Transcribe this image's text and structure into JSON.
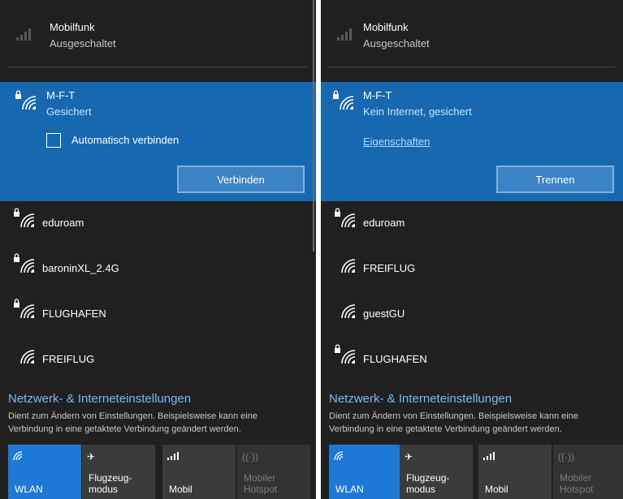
{
  "left": {
    "mobile": {
      "title": "Mobilfunk",
      "status": "Ausgeschaltet"
    },
    "selected": {
      "ssid": "M-F-T",
      "status": "Gesichert",
      "checkbox_label": "Automatisch verbinden",
      "button_label": "Verbinden"
    },
    "networks": [
      "eduroam",
      "baroninXL_2.4G",
      "FLUGHAFEN",
      "FREIFLUG"
    ]
  },
  "right": {
    "mobile": {
      "title": "Mobilfunk",
      "status": "Ausgeschaltet"
    },
    "selected": {
      "ssid": "M-F-T",
      "status": "Kein Internet, gesichert",
      "link_label": "Eigenschaften",
      "button_label": "Trennen"
    },
    "networks": [
      "eduroam",
      "FREIFLUG",
      "guestGU",
      "FLUGHAFEN"
    ]
  },
  "settings": {
    "title": "Netzwerk- & Interneteinstellungen",
    "description": "Dient zum Ändern von Einstellungen. Beispielsweise kann eine Verbindung in eine getaktete Verbindung geändert werden."
  },
  "tiles": [
    {
      "label": "WLAN",
      "icon": "wifi-icon",
      "state": "active"
    },
    {
      "label": "Flugzeug-\nmodus",
      "icon": "airplane-icon",
      "state": "normal"
    },
    {
      "label": "Mobil",
      "icon": "cellular-icon",
      "state": "normal"
    },
    {
      "label": "Mobiler\nHotspot",
      "icon": "hotspot-icon",
      "state": "disabled"
    }
  ],
  "colors": {
    "panel_bg": "#202020",
    "accent": "#1668b1",
    "link": "#7cb8ff",
    "tile_active": "#1e79d6"
  }
}
